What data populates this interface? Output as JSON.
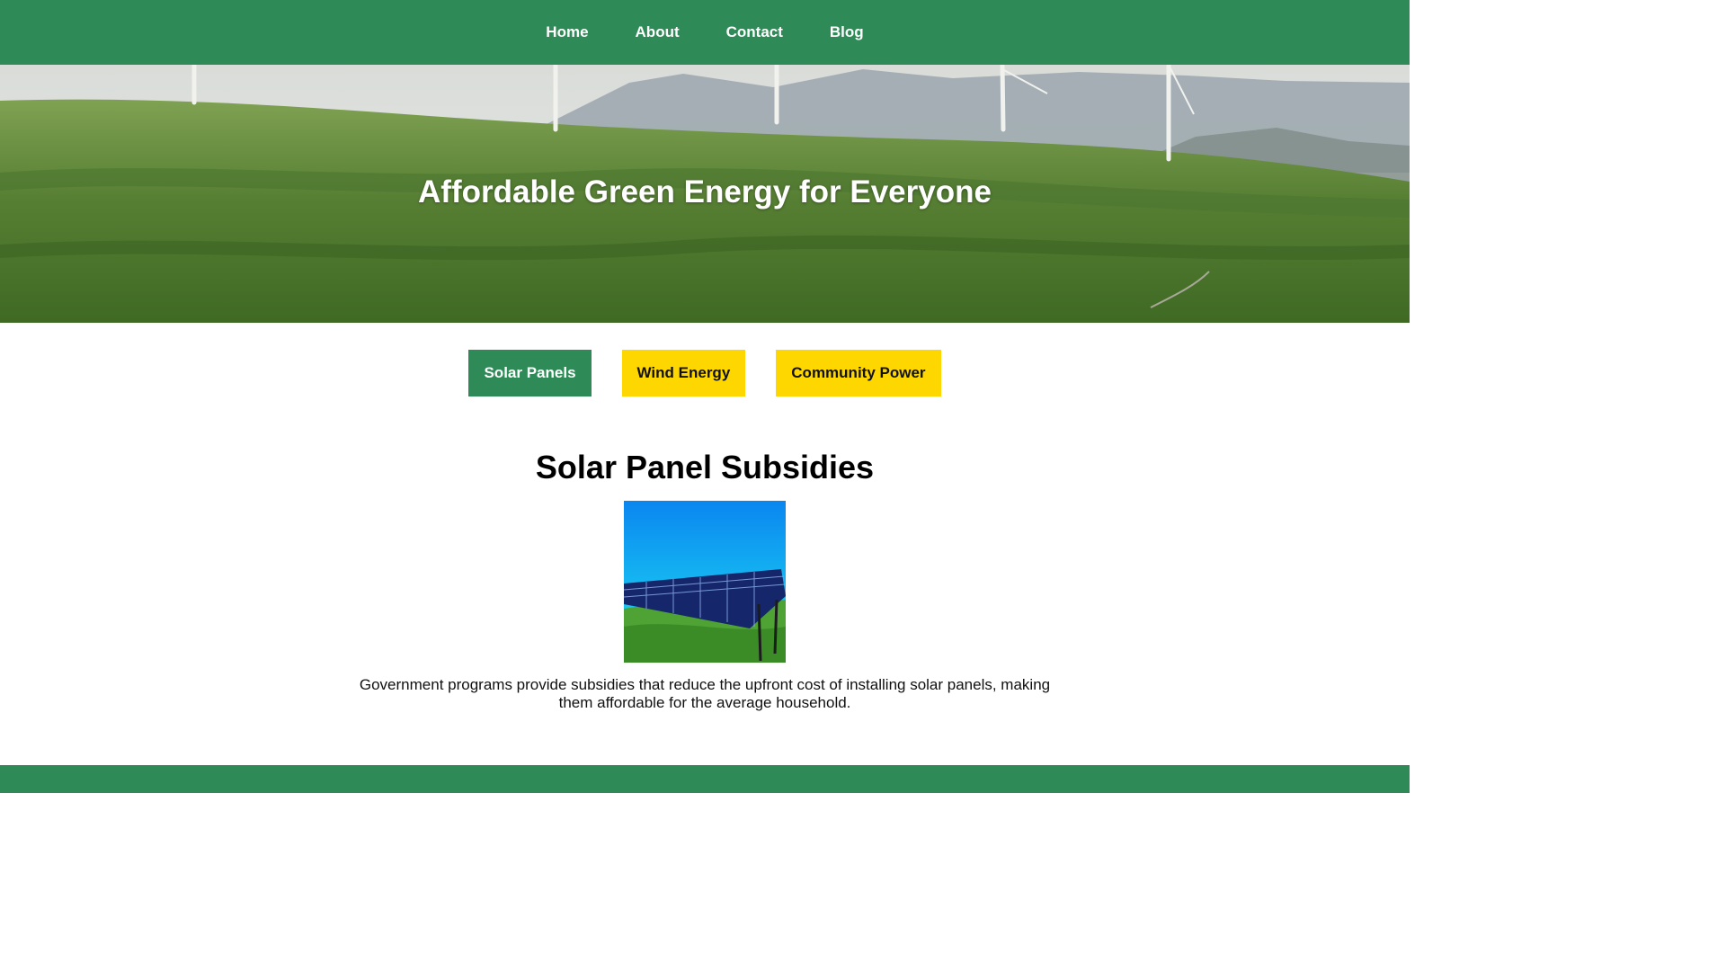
{
  "nav": {
    "items": [
      {
        "label": "Home"
      },
      {
        "label": "About"
      },
      {
        "label": "Contact"
      },
      {
        "label": "Blog"
      }
    ]
  },
  "hero": {
    "title": "Affordable Green Energy for Everyone",
    "image": "wind-turbines-on-green-hills"
  },
  "tabs": {
    "items": [
      {
        "label": "Solar Panels",
        "active": true
      },
      {
        "label": "Wind Energy",
        "active": false
      },
      {
        "label": "Community Power",
        "active": false
      }
    ]
  },
  "section": {
    "title": "Solar Panel Subsidies",
    "image": "solar-panel-array-on-grass",
    "text": "Government programs provide subsidies that reduce the upfront cost of installing solar panels, making them affordable for the average household."
  },
  "colors": {
    "primary_green": "#2e8b57",
    "accent_yellow": "#ffd700",
    "text_dark": "#111111",
    "background": "#ffffff"
  }
}
